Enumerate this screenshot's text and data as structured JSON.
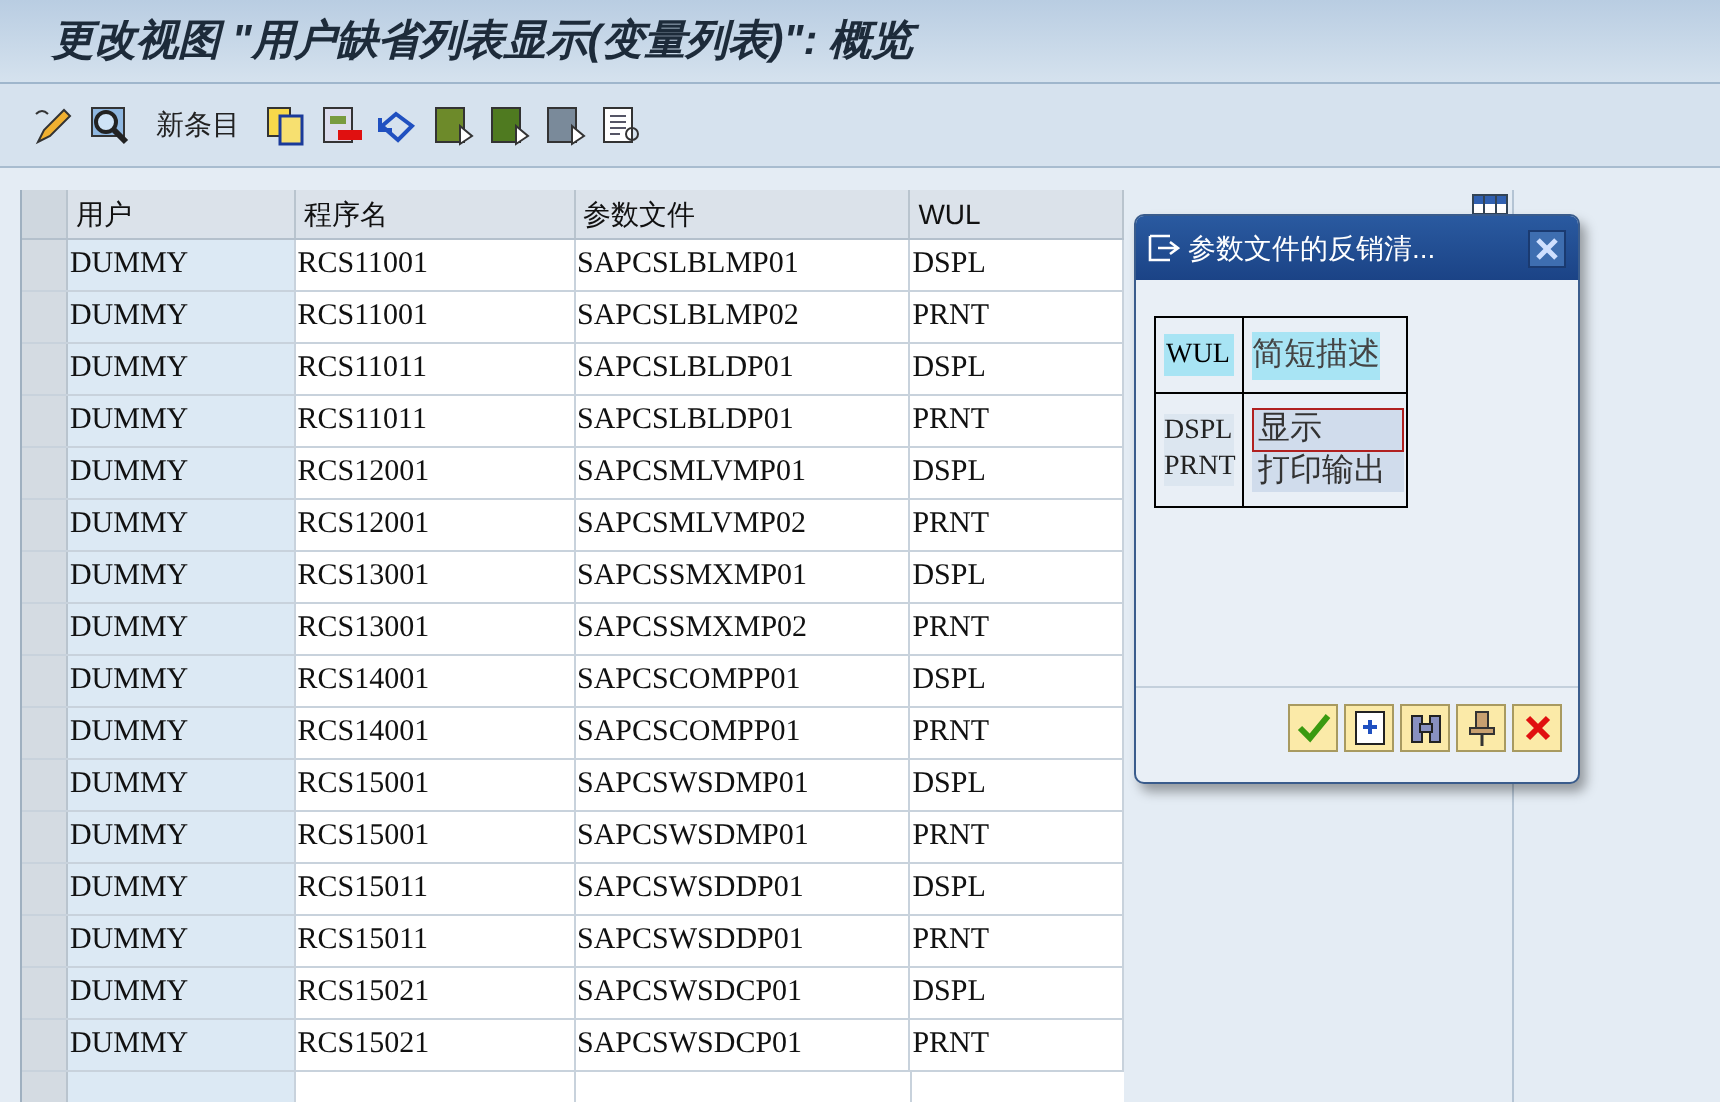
{
  "window": {
    "title": "更改视图 \"用户缺省列表显示(变量列表)\": 概览"
  },
  "toolbar": {
    "new_entries": "新条目"
  },
  "table": {
    "columns": [
      "用户",
      "程序名",
      "参数文件",
      "WUL"
    ],
    "rows": [
      [
        "DUMMY",
        "RCS11001",
        "SAPCSLBLMP01",
        "DSPL"
      ],
      [
        "DUMMY",
        "RCS11001",
        "SAPCSLBLMP02",
        "PRNT"
      ],
      [
        "DUMMY",
        "RCS11011",
        "SAPCSLBLDP01",
        "DSPL"
      ],
      [
        "DUMMY",
        "RCS11011",
        "SAPCSLBLDP01",
        "PRNT"
      ],
      [
        "DUMMY",
        "RCS12001",
        "SAPCSMLVMP01",
        "DSPL"
      ],
      [
        "DUMMY",
        "RCS12001",
        "SAPCSMLVMP02",
        "PRNT"
      ],
      [
        "DUMMY",
        "RCS13001",
        "SAPCSSMXMP01",
        "DSPL"
      ],
      [
        "DUMMY",
        "RCS13001",
        "SAPCSSMXMP02",
        "PRNT"
      ],
      [
        "DUMMY",
        "RCS14001",
        "SAPCSCOMPP01",
        "DSPL"
      ],
      [
        "DUMMY",
        "RCS14001",
        "SAPCSCOMPP01",
        "PRNT"
      ],
      [
        "DUMMY",
        "RCS15001",
        "SAPCSWSDMP01",
        "DSPL"
      ],
      [
        "DUMMY",
        "RCS15001",
        "SAPCSWSDMP01",
        "PRNT"
      ],
      [
        "DUMMY",
        "RCS15011",
        "SAPCSWSDDP01",
        "DSPL"
      ],
      [
        "DUMMY",
        "RCS15011",
        "SAPCSWSDDP01",
        "PRNT"
      ],
      [
        "DUMMY",
        "RCS15021",
        "SAPCSWSDCP01",
        "DSPL"
      ],
      [
        "DUMMY",
        "RCS15021",
        "SAPCSWSDCP01",
        "PRNT"
      ]
    ]
  },
  "dialog": {
    "title": "参数文件的反销清...",
    "columns": [
      "WUL",
      "简短描述"
    ],
    "values": [
      {
        "code": "DSPL",
        "description": "显示",
        "selected": true
      },
      {
        "code": "PRNT",
        "description": "打印输出",
        "selected": false
      }
    ]
  }
}
